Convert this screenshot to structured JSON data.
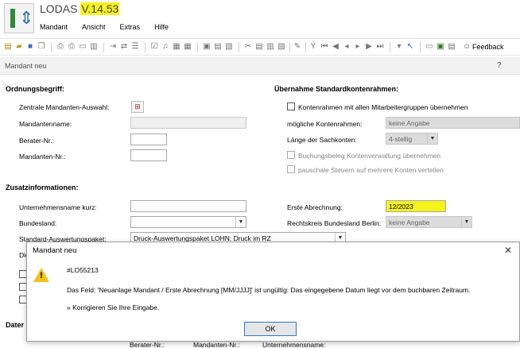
{
  "app": {
    "name": "LODAS",
    "version": "V.14.53"
  },
  "menu": [
    "Mandant",
    "Ansicht",
    "Extras",
    "Hilfe"
  ],
  "toolbar": {
    "feedback_label": "Feedback"
  },
  "subheader": {
    "title": "Mandant neu",
    "help": "?"
  },
  "left": {
    "ordnung_heading": "Ordnungsbegriff:",
    "zentrale_label": "Zentrale Mandanten-Auswahl:",
    "mandantenname_label": "Mandantenname:",
    "berater_label": "Berater-Nr.:",
    "mandanten_nr_label": "Mandanten-Nr.:",
    "zusatz_heading": "Zusatzinformationen:",
    "unternehmen_label": "Unternehmensname kurz:",
    "bundesland_label": "Bundesland:",
    "standard_label": "Standard-Auswertungspaket:",
    "standard_value": "Druck-Auswertungspaket LOHN: Druck im RZ",
    "die_label": "Die",
    "dater_label": "Dater"
  },
  "right": {
    "uebernahme_heading": "Übernahme Standardkontenrahmen:",
    "kontenrahmen_cb_label": "Kontenrahmen mit allen Mitarbeitergruppen übernehmen",
    "moegliche_label": "mögliche Kontenrahmen:",
    "moegliche_value": "keine Angabe",
    "laenge_label": "Länge der Sachkonten:",
    "laenge_value": "4-stellig",
    "buchungsbeleg_label": "Buchungsbeleg Kontenverwaltung übernehmen",
    "pauschale_label": "pauschale Steuern auf mehrere Konten verteilen",
    "erste_label": "Erste Abrechnung:",
    "erste_value": "12/2023",
    "rechtskreis_label": "Rechtskreis Bundesland Berlin:",
    "rechtskreis_value": "keine Angabe"
  },
  "bottom_columns": {
    "berater": "Berater-Nr.:",
    "mandanten": "Mandanten-Nr.:",
    "unternehmen": "Unternehmensname:"
  },
  "dialog": {
    "title": "Mandant neu",
    "code": "#LO55213",
    "message": "Das Feld: 'Neuanlage Mandant / Erste Abrechnung [MM/JJJJ]' ist ungültig: Das eingegebene Datum liegt vor dem buchbaren Zeitraum.",
    "hint": "» Korrigieren Sie Ihre Eingabe.",
    "ok_label": "OK"
  },
  "colors": {
    "highlight": "#f5f21c",
    "accent": "#2f76c6",
    "warning": "#f2c11b"
  }
}
